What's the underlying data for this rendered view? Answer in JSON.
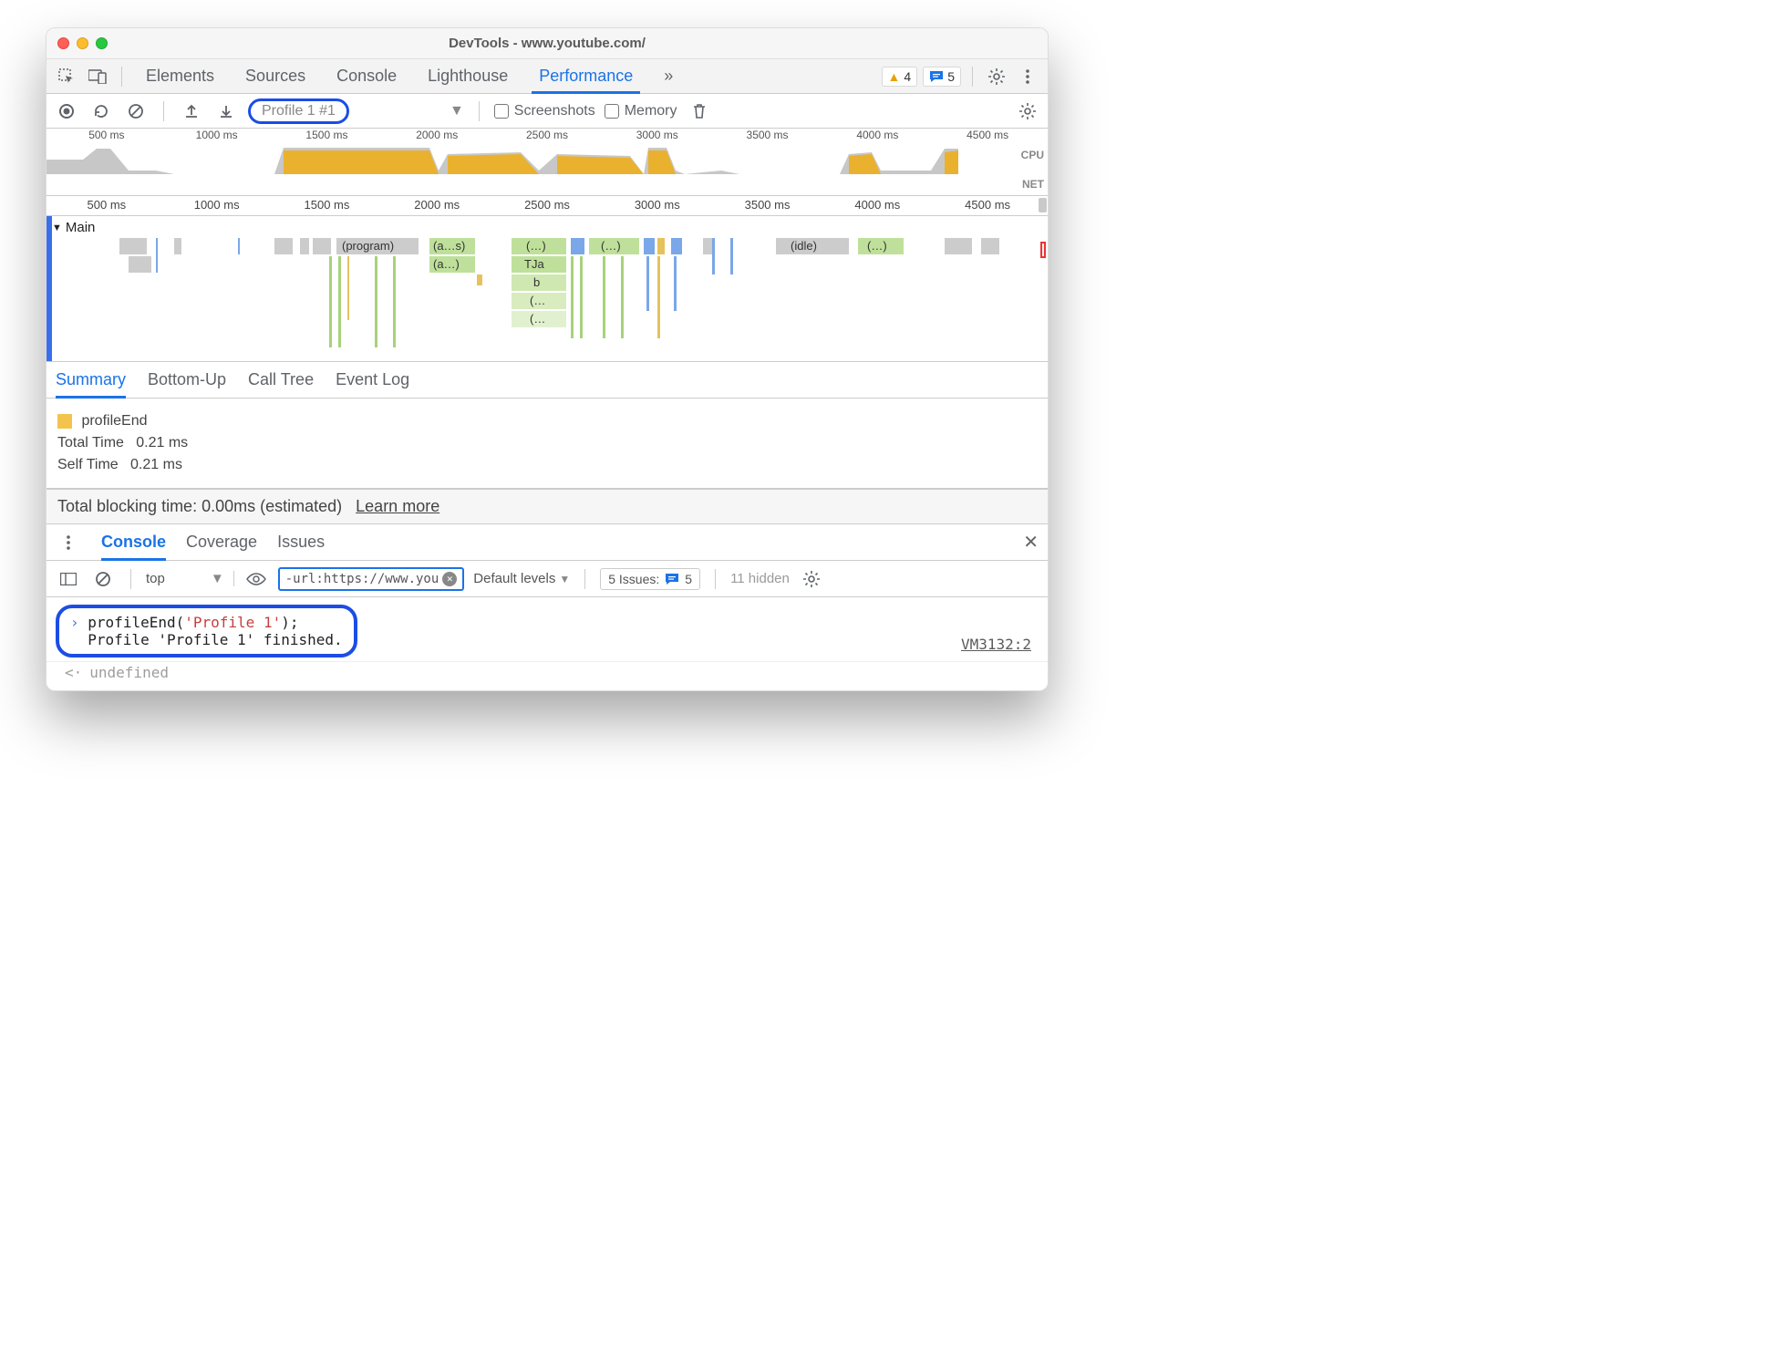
{
  "window": {
    "title": "DevTools - www.youtube.com/"
  },
  "mainTabs": {
    "items": [
      "Elements",
      "Sources",
      "Console",
      "Lighthouse",
      "Performance"
    ],
    "active": 4,
    "more": "»"
  },
  "badges": {
    "warnings": "4",
    "messages": "5"
  },
  "perfToolbar": {
    "profileName": "Profile 1 #1",
    "screenshotsLabel": "Screenshots",
    "memoryLabel": "Memory"
  },
  "timeline": {
    "ticks": [
      "500 ms",
      "1000 ms",
      "1500 ms",
      "2000 ms",
      "2500 ms",
      "3000 ms",
      "3500 ms",
      "4000 ms",
      "4500 ms"
    ],
    "cpuLabel": "CPU",
    "netLabel": "NET"
  },
  "flame": {
    "mainLabel": "Main",
    "blocks": {
      "program": "(program)",
      "as": "(a…s)",
      "a": "(a…)",
      "ellipsis": "(…)",
      "tja": "TJa",
      "b": "b",
      "idle": "(idle)"
    }
  },
  "subTabs": {
    "items": [
      "Summary",
      "Bottom-Up",
      "Call Tree",
      "Event Log"
    ],
    "active": 0
  },
  "summary": {
    "eventName": "profileEnd",
    "totalLabel": "Total Time",
    "totalValue": "0.21 ms",
    "selfLabel": "Self Time",
    "selfValue": "0.21 ms"
  },
  "tbt": {
    "text": "Total blocking time: 0.00ms (estimated)",
    "learnMore": "Learn more"
  },
  "drawer": {
    "tabs": [
      "Console",
      "Coverage",
      "Issues"
    ],
    "active": 0
  },
  "consoleToolbar": {
    "context": "top",
    "filter": "-url:https://www.you",
    "levels": "Default levels",
    "issuesLabel": "5 Issues:",
    "issuesCount": "5",
    "hidden": "11 hidden"
  },
  "consoleBody": {
    "inputPrefix": "profileEnd(",
    "inputString": "'Profile 1'",
    "inputSuffix": ");",
    "output": "Profile 'Profile 1' finished.",
    "undefined": "undefined",
    "vmLink": "VM3132:2"
  }
}
